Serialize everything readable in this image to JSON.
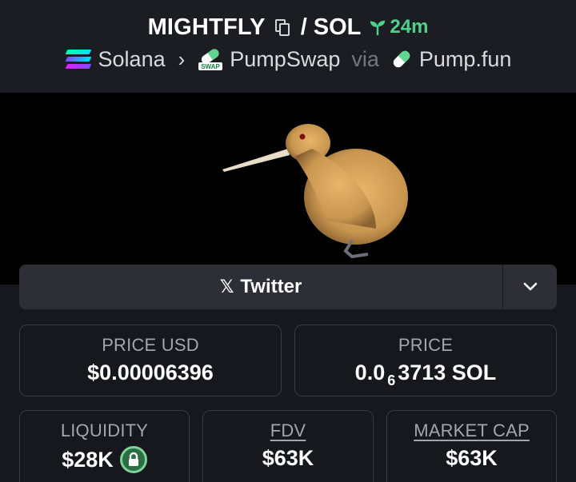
{
  "header": {
    "token_symbol": "MIGHTFLY",
    "separator": "/",
    "quote_symbol": "SOL",
    "age": "24m",
    "chain": "Solana",
    "dex": "PumpSwap",
    "dex_badge": "SWAP",
    "via_label": "via",
    "launchpad": "Pump.fun"
  },
  "social": {
    "twitter_label": "Twitter"
  },
  "stats": {
    "price_usd": {
      "label": "PRICE USD",
      "value": "$0.00006396"
    },
    "price_native": {
      "label": "PRICE",
      "prefix": "0.0",
      "zeros": "6",
      "suffix": "3713 SOL"
    },
    "liquidity": {
      "label": "LIQUIDITY",
      "value": "$28K"
    },
    "fdv": {
      "label": "FDV",
      "value": "$63K"
    },
    "market_cap": {
      "label": "MARKET CAP",
      "value": "$63K"
    }
  },
  "colors": {
    "accent_green": "#4fd18b",
    "background": "#17181d",
    "card_border": "#3a3b42"
  },
  "icons": [
    "copy-icon",
    "sprout-icon",
    "solana-icon",
    "chevron-right-icon",
    "pumpswap-icon",
    "pumpfun-pill-icon",
    "x-icon",
    "chevron-down-icon",
    "lock-icon"
  ]
}
